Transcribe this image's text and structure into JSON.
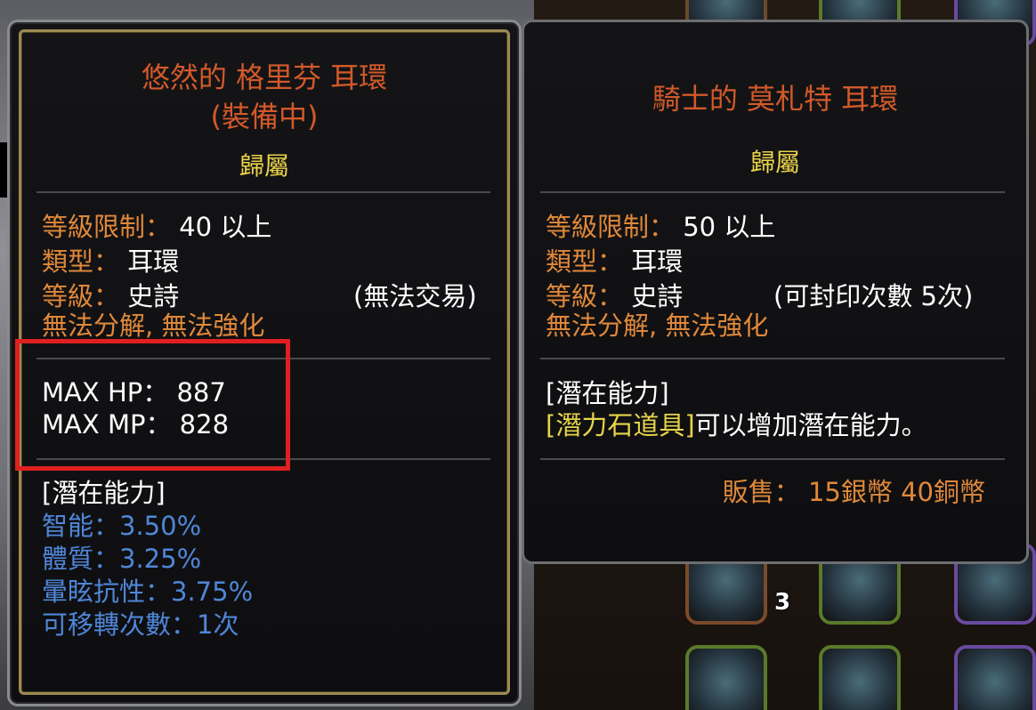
{
  "left_tooltip": {
    "title": "悠然的 格里芬 耳環",
    "equipped": "(裝備中)",
    "binding": "歸屬",
    "level_req_label": "等級限制：",
    "level_req_value": "40 以上",
    "type_label": "類型：",
    "type_value": "耳環",
    "grade_label": "等級：",
    "grade_value": "史詩",
    "trade_note": "(無法交易)",
    "restrictions": "無法分解, 無法強化",
    "stats": [
      "MAX HP： 887",
      "MAX MP： 828"
    ],
    "potential_header": "[潛在能力]",
    "potential_stats": [
      "智能：3.50%",
      "體質：3.25%",
      "暈眩抗性：3.75%",
      "可移轉次數：1次"
    ]
  },
  "right_tooltip": {
    "title": "騎士的 莫札特 耳環",
    "binding": "歸屬",
    "level_req_label": "等級限制：",
    "level_req_value": "50 以上",
    "type_label": "類型：",
    "type_value": "耳環",
    "grade_label": "等級：",
    "grade_value": "史詩",
    "seal_note": "(可封印次數 5次)",
    "restrictions": "無法分解, 無法強化",
    "potential_header": "[潛在能力]",
    "potential_item_link": "[潛力石道具]",
    "potential_text": "可以增加潛在能力。",
    "sell_price": "販售： 15銀幣 40銅幣"
  },
  "background": {
    "slot_count": "3"
  },
  "colors": {
    "title": "#d2592a",
    "binding": "#e9d24a",
    "label": "#e0883a",
    "potential_stat": "#4f86d8",
    "item_link": "#e6d44a",
    "highlight": "#e02020"
  }
}
